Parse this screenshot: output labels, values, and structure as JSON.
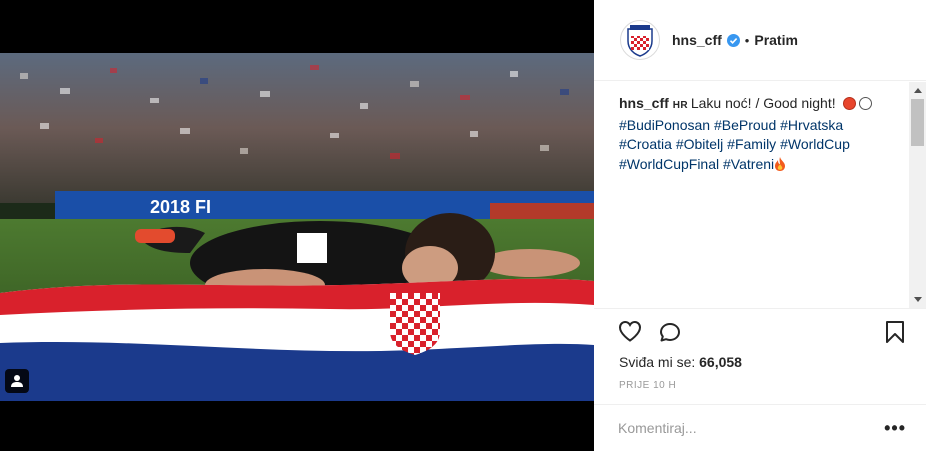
{
  "post": {
    "username": "hns_cff",
    "dot": "•",
    "follow_label": "Pratim",
    "caption": {
      "user": "hns_cff",
      "lang": "HR",
      "text": "Laku noć! / Good night!",
      "hashtags": [
        "#BudiPonosan",
        "#BeProud",
        "#Hrvatska",
        "#Croatia",
        "#Obitelj",
        "#Family",
        "#WorldCup",
        "#WorldCupFinal",
        "#Vatreni"
      ]
    },
    "likes_label": "Sviđa mi se:",
    "likes_count": "66,058",
    "time_label": "PRIJE 10 H",
    "comment_placeholder": "Komentiraj...",
    "more_label": "•••"
  },
  "photo": {
    "board_text": "2018 FI"
  },
  "colors": {
    "verified": "#3897f0",
    "hashtag": "#003569",
    "flag_red": "#d9212c",
    "flag_blue": "#1b3a8c"
  },
  "icons": [
    "verified-badge-icon",
    "heart-icon",
    "comment-icon",
    "bookmark-icon",
    "user-tag-icon",
    "fire-emoji-icon"
  ]
}
